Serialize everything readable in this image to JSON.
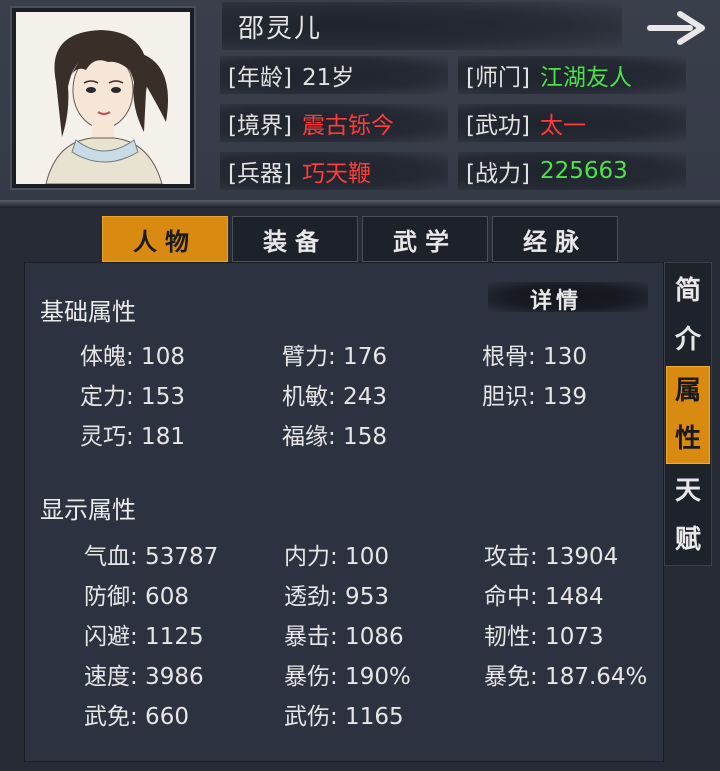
{
  "character": {
    "name": "邵灵儿",
    "info": [
      {
        "label": "[年龄]",
        "value": "21岁",
        "color": "#e2e2e2"
      },
      {
        "label": "[师门]",
        "value": "江湖友人",
        "color": "#4be24b"
      },
      {
        "label": "[境界]",
        "value": "震古铄今",
        "color": "#ff3a3a"
      },
      {
        "label": "[武功]",
        "value": "太一",
        "color": "#ff3a3a"
      },
      {
        "label": "[兵器]",
        "value": "巧天鞭",
        "color": "#ff3a3a"
      },
      {
        "label": "[战力]",
        "value": "225663",
        "color": "#4be24b"
      }
    ]
  },
  "icons": {
    "next": "arrow-right-icon",
    "portrait": "character-portrait"
  },
  "tabs": [
    {
      "label": "人物",
      "active": true
    },
    {
      "label": "装备",
      "active": false
    },
    {
      "label": "武学",
      "active": false
    },
    {
      "label": "经脉",
      "active": false
    }
  ],
  "side_tabs": [
    {
      "chars": [
        "简",
        "介"
      ],
      "active": false
    },
    {
      "chars": [
        "属",
        "性"
      ],
      "active": true
    },
    {
      "chars": [
        "天",
        "赋"
      ],
      "active": false
    }
  ],
  "detail_button": "详情",
  "basic": {
    "title": "基础属性",
    "stats": [
      "体魄: 108",
      "臂力: 176",
      "根骨: 130",
      "定力: 153",
      "机敏: 243",
      "胆识: 139",
      "灵巧: 181",
      "福缘: 158"
    ]
  },
  "display": {
    "title": "显示属性",
    "stats": [
      "气血: 53787",
      "内力: 100",
      "攻击: 13904",
      "防御: 608",
      "透劲: 953",
      "命中: 1484",
      "闪避: 1125",
      "暴击: 1086",
      "韧性: 1073",
      "速度: 3986",
      "暴伤: 190%",
      "暴免: 187.64%",
      "武免: 660",
      "武伤: 1165"
    ]
  },
  "colors": {
    "accent": "#d98a10",
    "red": "#ff3a3a",
    "green": "#4be24b"
  }
}
